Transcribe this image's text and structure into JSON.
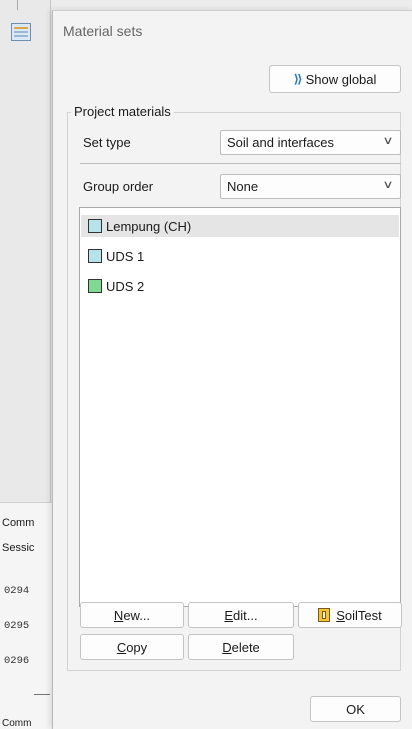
{
  "background": {
    "side_labels": [
      "Comm",
      "Sessic"
    ],
    "log_lines": [
      "0294",
      "0295",
      "0296"
    ],
    "bottom_label": "Comm"
  },
  "dialog": {
    "title": "Material sets",
    "show_global": {
      "label": "Show global",
      "mnemonic": "g"
    },
    "group_title": "Project materials",
    "set_type": {
      "label": "Set type",
      "value": "Soil and interfaces"
    },
    "group_order": {
      "label": "Group order",
      "value": "None"
    },
    "materials": [
      {
        "name": "Lempung (CH)",
        "color": "#b6e3ea",
        "selected": true
      },
      {
        "name": "UDS 1",
        "color": "#b6e3ea",
        "selected": false
      },
      {
        "name": "UDS 2",
        "color": "#7fd991",
        "selected": false
      }
    ],
    "buttons": {
      "new": "New...",
      "edit": "Edit...",
      "soiltest": "SoilTest",
      "copy": "Copy",
      "delete": "Delete",
      "ok": "OK"
    }
  }
}
